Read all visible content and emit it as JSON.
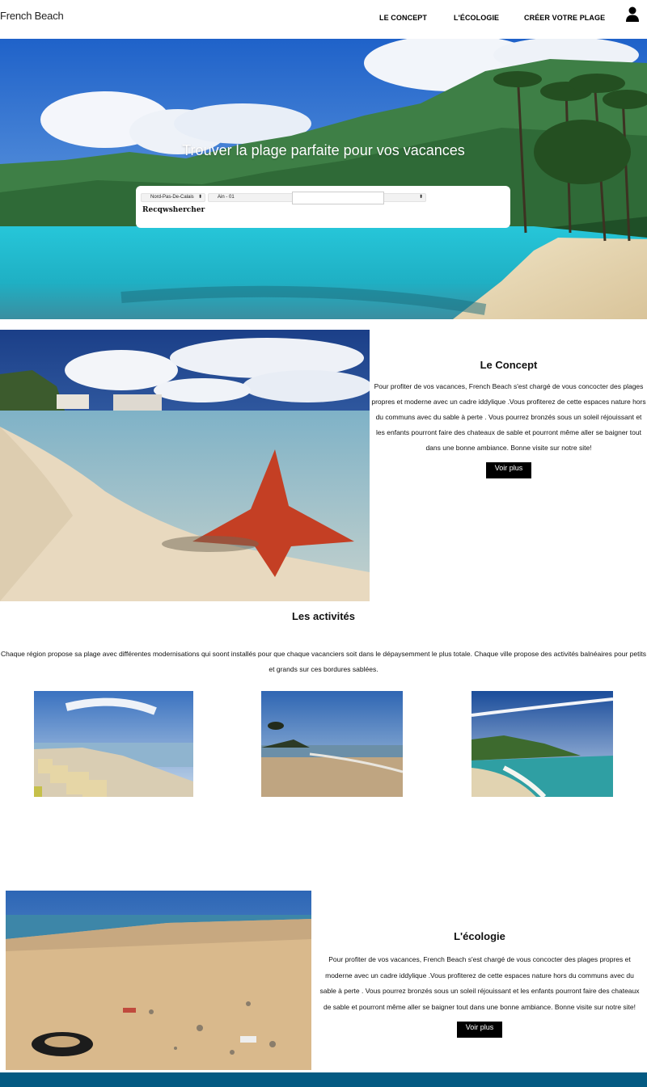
{
  "header": {
    "brand": "French Beach",
    "nav": [
      "LE CONCEPT",
      "L'ÉCOLOGIE",
      "CRÉER VOTRE PLAGE"
    ],
    "user_icon": "user-icon"
  },
  "hero": {
    "title": "Trouver la plage parfaite pour vos vacances",
    "region_select": "Nord-Pas-De-Calais",
    "department_select": "Ain - 01",
    "search_value": "",
    "search_button": "Recqwshercher"
  },
  "concept": {
    "title": "Le Concept",
    "text": "Pour profiter de vos vacances, French Beach s'est chargé de vous concocter des plages propres et moderne avec un cadre iddylique .Vous profiterez de cette espaces nature hors du communs avec du sable à perte . Vous pourrez bronzés sous un soleil réjouissant et les enfants pourront faire des chateaux de sable et pourront même aller se baigner tout dans une bonne ambiance. Bonne visite sur notre site!",
    "button": "Voir plus"
  },
  "activities": {
    "title": "Les activités",
    "text": "Chaque région propose sa plage avec différentes modernisations qui soont installés pour que chaque vacanciers soit dans le dépaysemment le plus totale. Chaque ville propose des activités balnéaires pour petits et grands sur ces bordures sablées."
  },
  "ecology": {
    "title": "L'écologie",
    "text": "Pour profiter de vos vacances, French Beach s'est chargé de vous concocter des plages propres et moderne avec un cadre iddylique .Vous profiterez de cette espaces nature hors du communs avec du sable à perte . Vous pourrez bronzés sous un soleil réjouissant et les enfants pourront faire des chateaux de sable et pourront même aller se baigner tout dans une bonne ambiance. Bonne visite sur notre site!",
    "button": "Voir plus"
  },
  "colors": {
    "footer": "#045a82",
    "button": "#000000"
  }
}
